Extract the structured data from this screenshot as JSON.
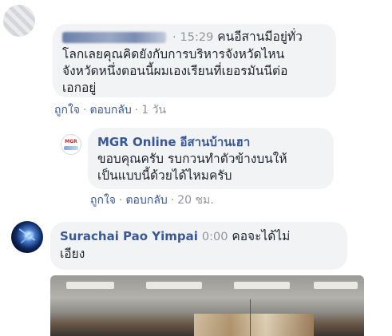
{
  "comments": [
    {
      "author": "",
      "time": "15:29",
      "text_lines": [
        "คนอีสานมีอยู่ทั่ว",
        "โลกเลยคุณคิดยังกับการบริหารจังหวัดไหน",
        "จังหวัดหนึ่งตอนนี้ผมเองเรียนที่เยอรมันนีต่อ",
        "เอกอยู่"
      ],
      "like_label": "ถูกใจ",
      "reply_label": "ตอบกลับ",
      "age": "1 วัน"
    },
    {
      "author": "MGR Online",
      "page_name": "อีสานบ้านเฮา",
      "text_lines": [
        "ขอบคุณครับ รบกวนทำตัวข้างบนให้",
        "เป็นแบบนี้ด้วยได้ไหมครับ"
      ],
      "avatar_text": "MGR",
      "like_label": "ถูกใจ",
      "reply_label": "ตอบกลับ",
      "age": "20 ชม."
    },
    {
      "author": "Surachai Pao Yimpai",
      "time": "0:00",
      "text_lines": [
        "คอจะได้ไม่",
        "เอียง"
      ]
    }
  ],
  "separator": "·",
  "colors": {
    "author": "#385898",
    "bubble": "#f2f3f5",
    "meta": "#90949c"
  }
}
